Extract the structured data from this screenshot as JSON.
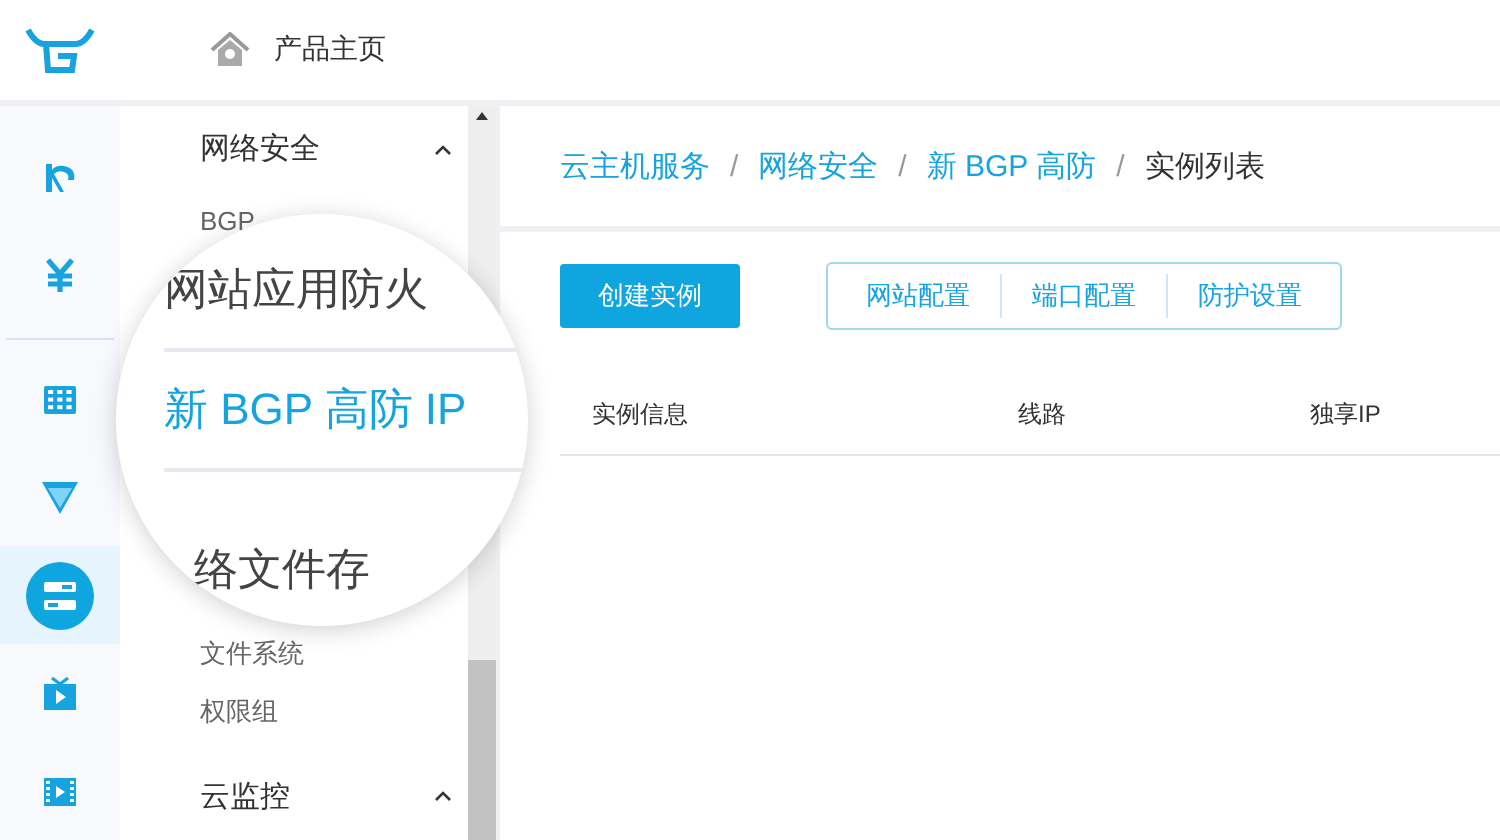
{
  "header": {
    "title": "产品主页"
  },
  "rail": [
    {
      "kind": "brand",
      "selected": false
    },
    {
      "kind": "yen",
      "selected": false
    },
    {
      "kind": "grid",
      "selected": false
    },
    {
      "kind": "funnel",
      "selected": false
    },
    {
      "kind": "storage",
      "selected": true
    },
    {
      "kind": "tv",
      "selected": false
    },
    {
      "kind": "film",
      "selected": false
    }
  ],
  "nav_top": [
    {
      "kind": "group",
      "label": "网络安全",
      "expanded": true
    },
    {
      "kind": "item",
      "label": "BGP"
    }
  ],
  "nav_bottom": [
    {
      "kind": "item",
      "label": "文件系统"
    },
    {
      "kind": "item",
      "label": "权限组"
    },
    {
      "kind": "group",
      "label": "云监控",
      "expanded": true
    }
  ],
  "magnifier": {
    "items": [
      {
        "label": "网站应用防火",
        "selected": false
      },
      {
        "label": "新 BGP 高防 IP",
        "selected": true
      },
      {
        "label": "络文件存",
        "selected": false
      }
    ]
  },
  "breadcrumb": {
    "separator": "/",
    "items": [
      {
        "label": "云主机服务",
        "link": true
      },
      {
        "label": "网络安全",
        "link": true
      },
      {
        "label": "新 BGP 高防",
        "link": true
      },
      {
        "label": "实例列表",
        "link": false
      }
    ]
  },
  "toolbar": {
    "primary": "创建实例",
    "group": [
      "网站配置",
      "端口配置",
      "防护设置"
    ]
  },
  "table": {
    "columns": [
      "实例信息",
      "线路",
      "独享IP"
    ]
  }
}
